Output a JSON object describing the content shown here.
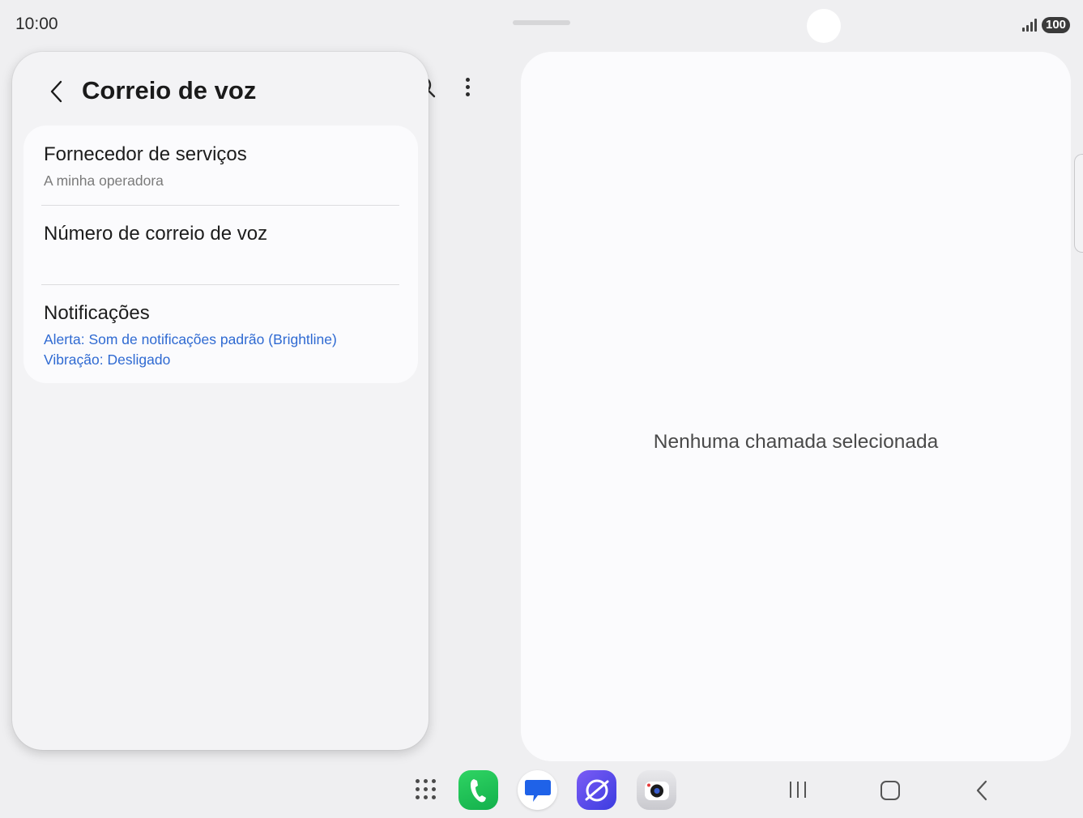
{
  "status_bar": {
    "time": "10:00",
    "battery": "100"
  },
  "panel": {
    "title": "Correio de voz",
    "items": [
      {
        "title": "Fornecedor de serviços",
        "subtitle": "A minha operadora"
      },
      {
        "title": "Número de correio de voz"
      },
      {
        "title": "Notificações",
        "detail_lines": [
          "Alerta: Som de notificações padrão (Brightline)",
          "Vibração: Desligado"
        ]
      }
    ]
  },
  "detail": {
    "empty_message": "Nenhuma chamada selecionada"
  },
  "colors": {
    "accent_blue": "#2f6ad2",
    "background": "#efeff1",
    "card": "#fbfbfd"
  },
  "taskbar": {
    "apps": [
      "phone-app-icon",
      "messages-app-icon",
      "internet-app-icon",
      "camera-app-icon"
    ],
    "nav": [
      "recents-icon",
      "home-icon",
      "back-icon"
    ]
  }
}
